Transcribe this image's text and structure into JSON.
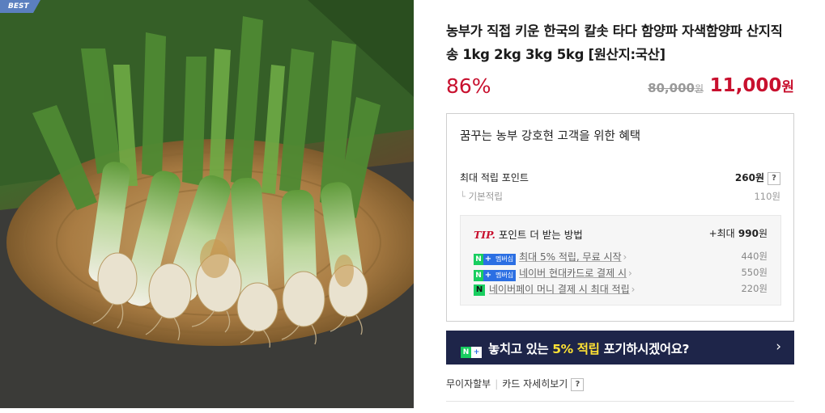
{
  "badge": {
    "best": "BEST"
  },
  "product": {
    "title": "농부가 직접 키운 한국의 칼솟 타다 함양파 자색함양파 산지직송 1kg 2kg 3kg 5kg [원산지:국산]",
    "discount_rate": "86%",
    "original_price": "80,000",
    "original_price_unit": "원",
    "sale_price": "11,000",
    "sale_price_unit": "원"
  },
  "benefit": {
    "heading": "꿈꾸는 농부 강호현 고객을 위한 혜택",
    "max_point_label": "최대 적립 포인트",
    "max_point_value": "260원",
    "help_icon": "?",
    "basic_label": "기본적립",
    "basic_value": "110원",
    "tip": {
      "tip_label": "TIP.",
      "title": "포인트 더 받는 방법",
      "max_prefix": "+최대",
      "max_value": "990",
      "max_unit": "원",
      "items": [
        {
          "icon": "naver-plus-membership-badge",
          "badge_n": "N",
          "badge_plus": "+",
          "badge_mem": "멤버십",
          "text": "최대 5% 적립, 무료 시작",
          "chevron": "›",
          "amount": "440원"
        },
        {
          "icon": "naver-plus-membership-badge",
          "badge_n": "N",
          "badge_plus": "+",
          "badge_mem": "멤버십",
          "text": "네이버 현대카드로 결제 시",
          "chevron": "›",
          "amount": "550원"
        },
        {
          "icon": "naver-pay-icon",
          "badge_n": "N",
          "text": "네이버페이 머니 결제 시 최대 적립",
          "chevron": "›",
          "amount": "220원"
        }
      ]
    }
  },
  "banner": {
    "badge_n": "N",
    "badge_plus": "+",
    "text_before": "놓치고 있는 ",
    "text_highlight": "5% 적립",
    "text_after": " 포기하시겠어요?",
    "chevron": "›"
  },
  "links": {
    "installment": "무이자할부",
    "card_detail": "카드 자세히보기",
    "help": "?"
  },
  "colors": {
    "accent_red": "#c8102e",
    "banner_bg": "#1e2549",
    "banner_highlight": "#ffe234",
    "naver_green": "#19ce60",
    "membership_blue": "#2b6fe3"
  }
}
